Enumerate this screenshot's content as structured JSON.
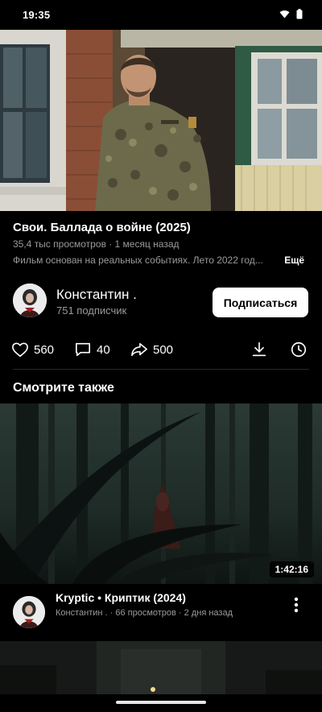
{
  "status_bar": {
    "time": "19:35",
    "icons": [
      "wifi-icon",
      "battery-icon"
    ]
  },
  "video": {
    "title": "Свои. Баллада о войне (2025)",
    "meta": "35,4 тыс просмотров · 1 месяц назад",
    "description": "Фильм основан на реальных событиях. Лето 2022 год...",
    "more_label": "Ещё"
  },
  "channel": {
    "name": "Константин .",
    "subscribers": "751 подписчик",
    "subscribe_label": "Подписаться"
  },
  "actions": {
    "likes": "560",
    "comments": "40",
    "shares": "500",
    "icons": [
      "heart-icon",
      "comment-icon",
      "share-icon",
      "download-icon",
      "clock-icon"
    ]
  },
  "section": {
    "title": "Смотрите также"
  },
  "recommendations": [
    {
      "title": "Kryptic • Криптик (2024)",
      "meta": "Константин . · 66 просмотров · 2 дня назад",
      "duration": "1:42:16"
    }
  ],
  "colors": {
    "background": "#000000",
    "secondary_text": "#9a9a9a",
    "button_bg": "#ffffff"
  }
}
